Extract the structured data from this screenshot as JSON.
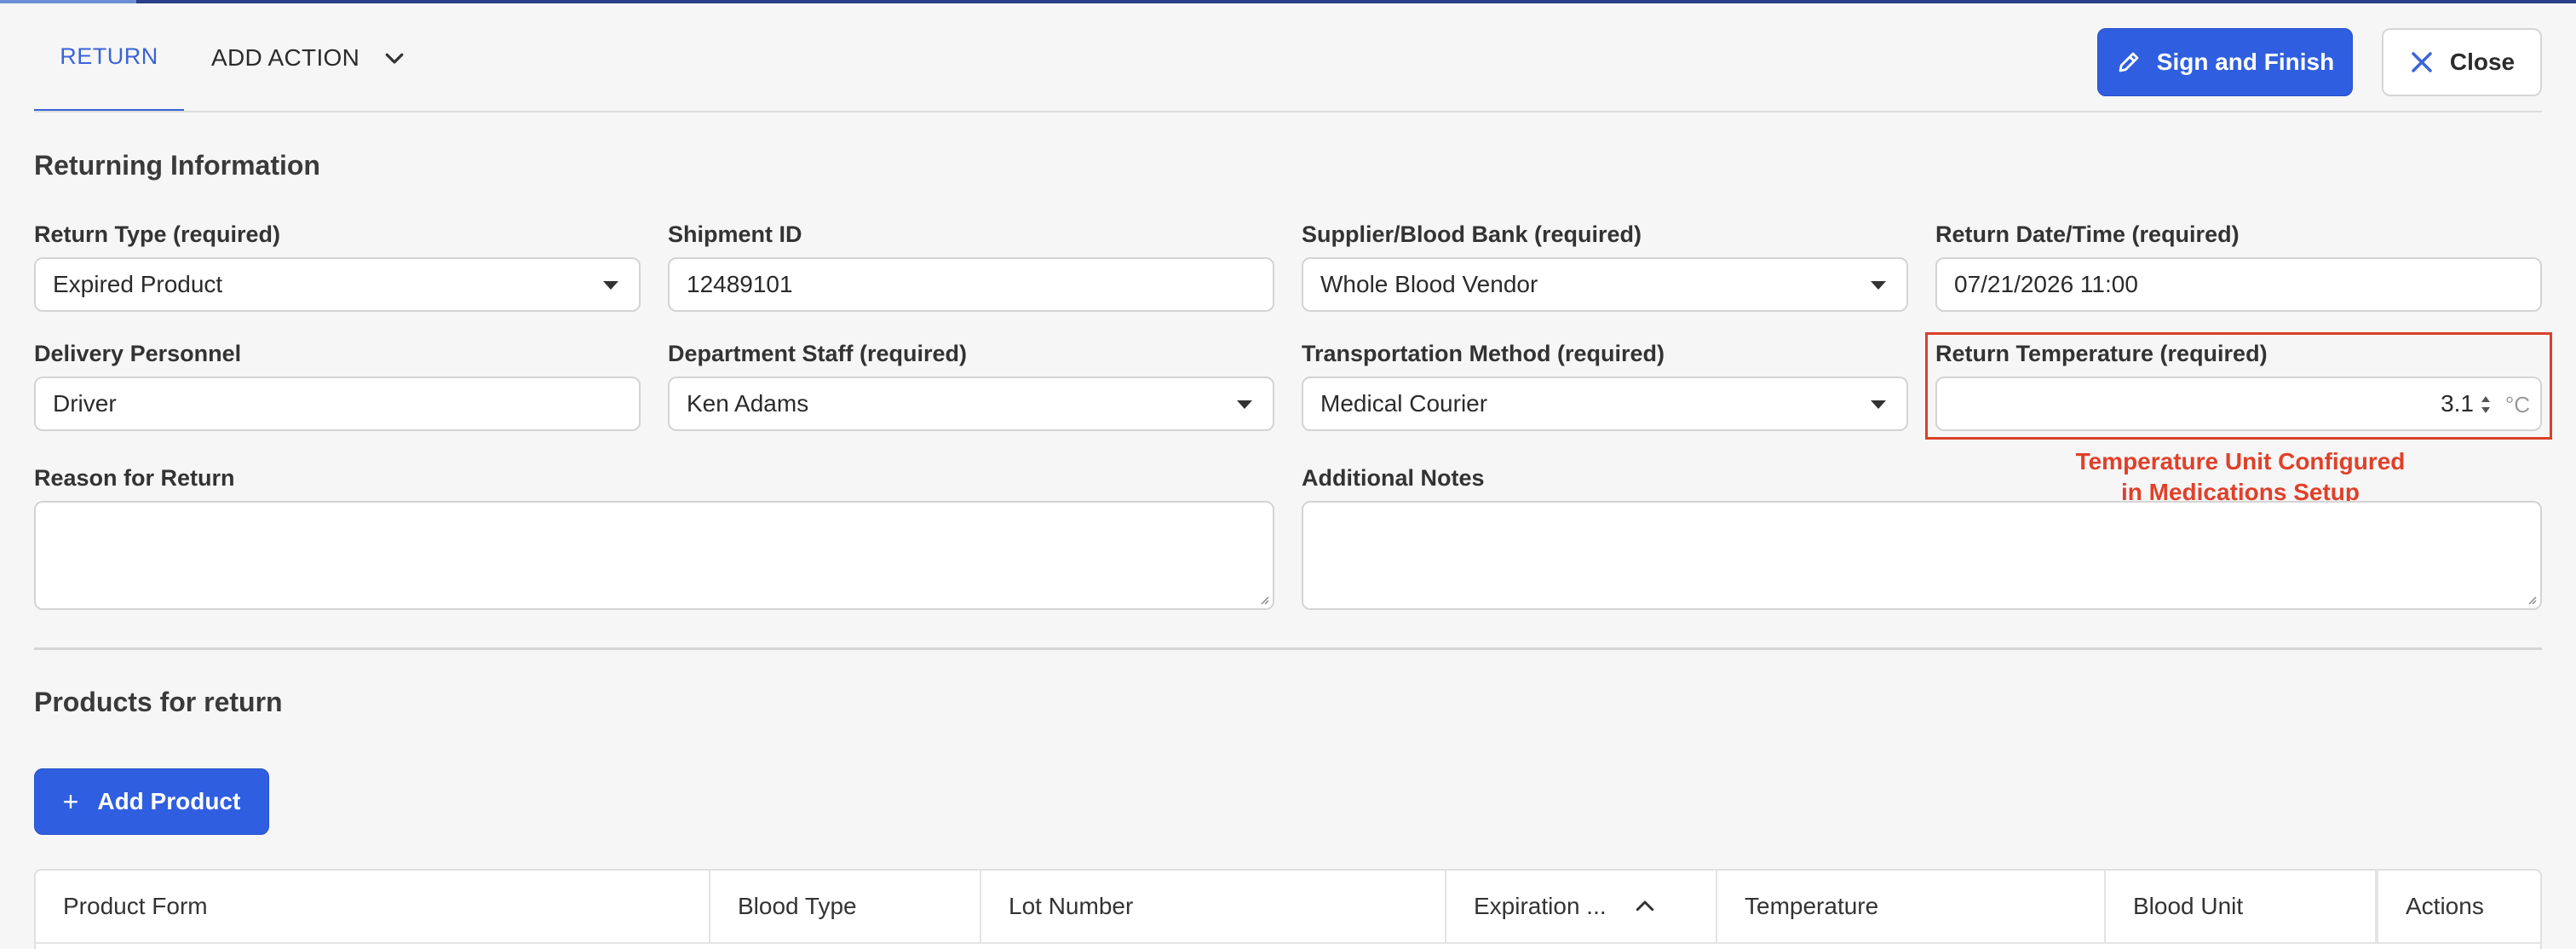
{
  "header": {
    "tab_return": "RETURN",
    "tab_add_action": "ADD ACTION",
    "sign_button": "Sign and Finish",
    "close_button": "Close"
  },
  "returning_info": {
    "title": "Returning Information",
    "return_type": {
      "label": "Return Type (required)",
      "value": "Expired Product"
    },
    "shipment_id": {
      "label": "Shipment ID",
      "value": "12489101"
    },
    "supplier": {
      "label": "Supplier/Blood Bank (required)",
      "value": "Whole Blood Vendor"
    },
    "return_datetime": {
      "label": "Return Date/Time (required)",
      "value": "07/21/2026 11:00"
    },
    "delivery_personnel": {
      "label": "Delivery Personnel",
      "value": "Driver"
    },
    "department_staff": {
      "label": "Department Staff (required)",
      "value": "Ken Adams"
    },
    "transport_method": {
      "label": "Transportation Method (required)",
      "value": "Medical Courier"
    },
    "return_temperature": {
      "label": "Return Temperature (required)",
      "value": "3.1",
      "unit": "°C"
    },
    "temperature_note_line1": "Temperature Unit Configured",
    "temperature_note_line2": "in Medications Setup",
    "reason": {
      "label": "Reason for Return",
      "value": ""
    },
    "notes": {
      "label": "Additional Notes",
      "value": ""
    }
  },
  "products": {
    "title": "Products for return",
    "add_button": "Add Product",
    "columns": [
      "Product Form",
      "Blood Type",
      "Lot Number",
      "Expiration ...",
      "Temperature",
      "Blood Unit",
      "Actions"
    ]
  },
  "colors": {
    "accent": "#2f5fe0",
    "highlight": "#d9402b"
  }
}
